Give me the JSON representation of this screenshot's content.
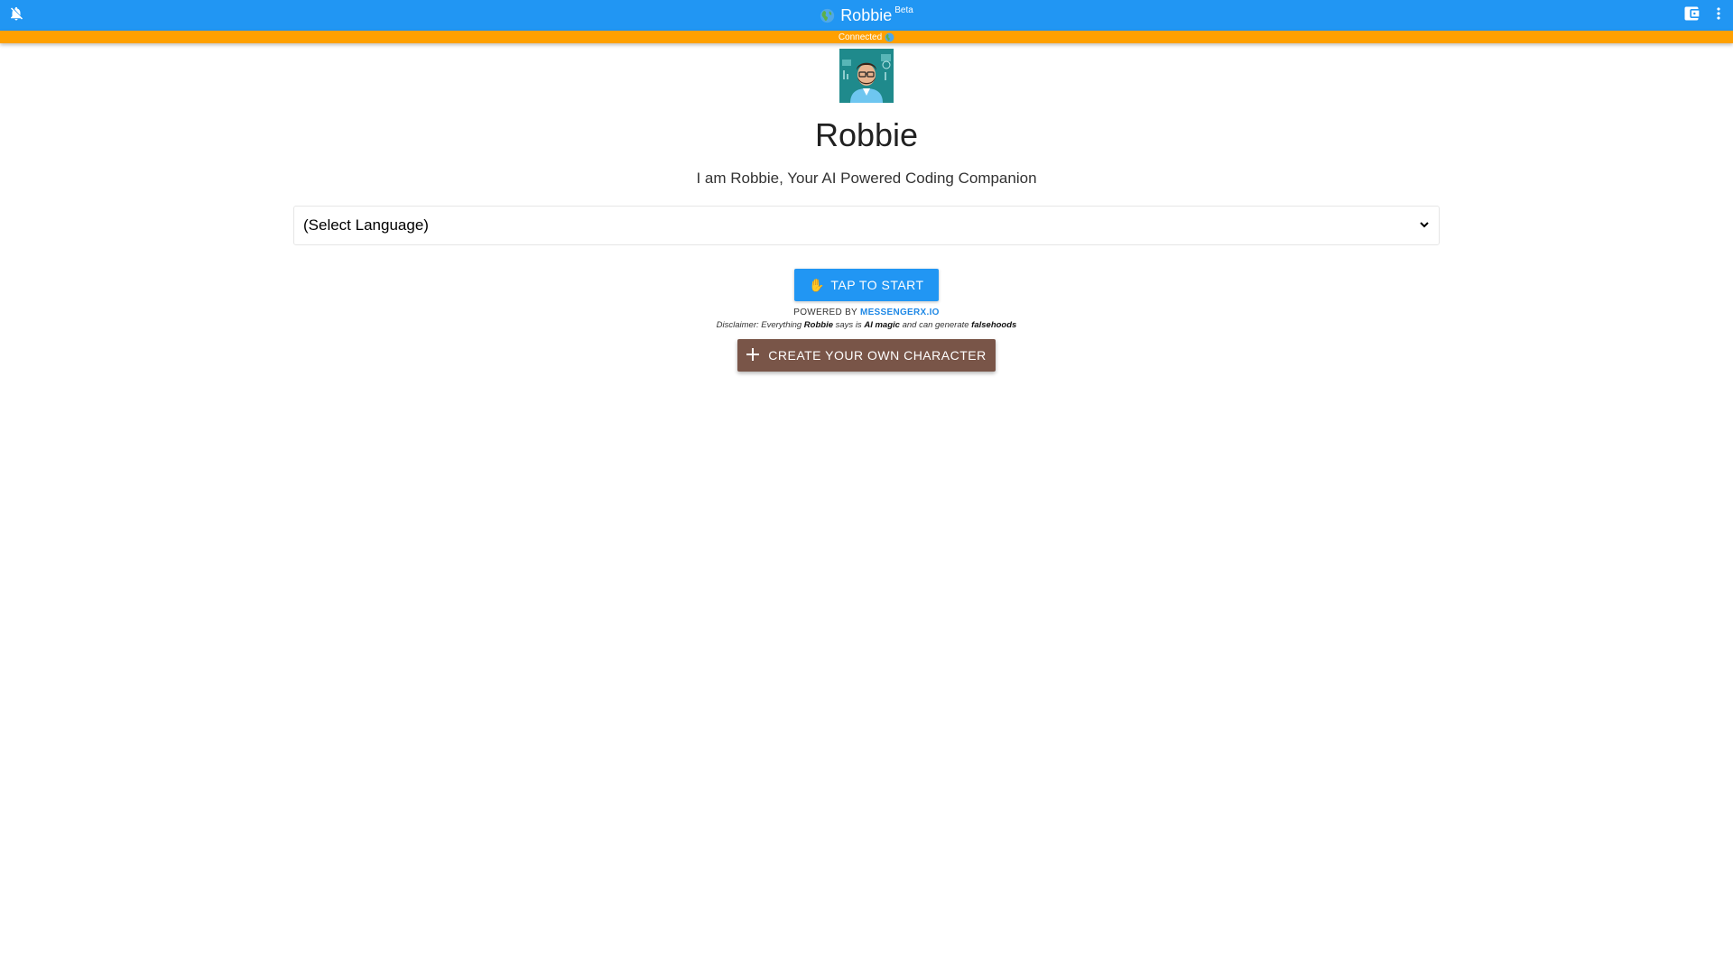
{
  "app": {
    "title": "Robbie",
    "badge": "Beta",
    "status": "Connected",
    "colors": {
      "appbar": "#2196f3",
      "status_bar": "#ffa000",
      "start_button": "#2196f3",
      "create_button": "#795548",
      "link": "#1e88e5"
    }
  },
  "toolbar": {
    "left_icon": "notifications-off-icon",
    "right_icons": [
      "wallet-icon",
      "more-vert-icon"
    ]
  },
  "character": {
    "name": "Robbie",
    "tagline": "I am Robbie, Your AI Powered Coding Companion",
    "avatar_icon": "robbie-avatar"
  },
  "language_select": {
    "selected": "(Select Language)"
  },
  "start_button": {
    "emoji": "✋",
    "label": "TAP TO START"
  },
  "powered_by": {
    "prefix": "POWERED BY",
    "link": "MESSENGERX.IO"
  },
  "disclaimer": {
    "p1": "Disclaimer: Everything",
    "name": "Robbie",
    "p2": "says is",
    "ai": "AI magic",
    "p3": "and can generate",
    "falsehoods": "falsehoods"
  },
  "create_button": {
    "icon": "plus-icon",
    "label": "CREATE YOUR OWN CHARACTER"
  }
}
